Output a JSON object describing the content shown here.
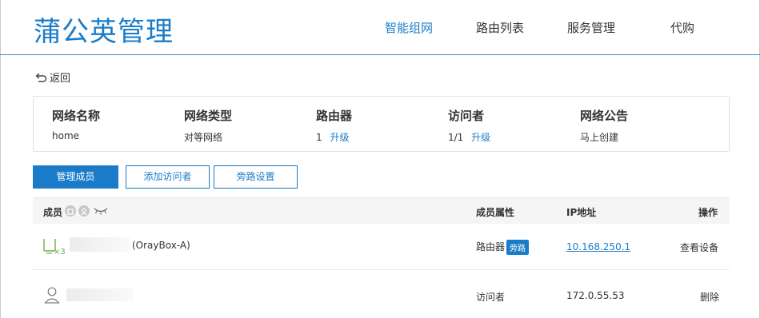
{
  "header": {
    "logo": "蒲公英管理",
    "nav": [
      "智能组网",
      "路由列表",
      "服务管理",
      "代购"
    ]
  },
  "back_label": "返回",
  "network_info": [
    {
      "label": "网络名称",
      "value": "home",
      "value_link": ""
    },
    {
      "label": "网络类型",
      "value": "对等网络",
      "value_link": ""
    },
    {
      "label": "路由器",
      "value": "1",
      "value_link": "升级"
    },
    {
      "label": "访问者",
      "value": "1/1",
      "value_link": "升级"
    },
    {
      "label": "网络公告",
      "value": "",
      "value_link": "马上创建"
    }
  ],
  "buttons": {
    "manage_members": "管理成员",
    "add_visitor": "添加访问者",
    "bypass_settings": "旁路设置"
  },
  "table": {
    "headers": {
      "member": "成员",
      "attribute": "成员属性",
      "ip": "IP地址",
      "action": "操作"
    },
    "rows": [
      {
        "name_suffix": "(OrayBox-A)",
        "icon_badge": "×3",
        "attribute": "路由器",
        "tag": "旁路",
        "ip": "10.168.250.1",
        "action": "查看设备"
      },
      {
        "name_suffix": "",
        "attribute": "访问者",
        "tag": "",
        "ip": "172.0.55.53",
        "action": "删除"
      }
    ]
  },
  "colors": {
    "accent": "#1a7cc9",
    "border": "#e2e2e2",
    "header_bg": "#f5f5f5"
  }
}
